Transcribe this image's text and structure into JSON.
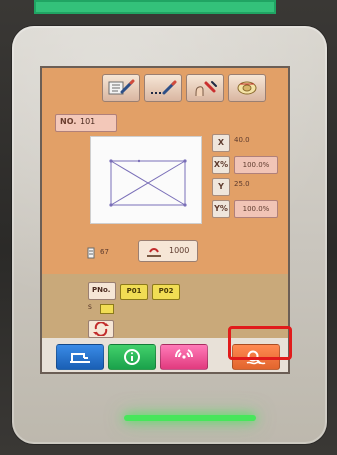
{
  "screen": {
    "pattern_no_label": "NO.",
    "pattern_no_value": "101",
    "x_label": "X",
    "x_value": "40.0",
    "x_scale_label": "X%",
    "x_scale_value": "100.0%",
    "y_label": "Y",
    "y_value": "25.0",
    "y_scale_label": "Y%",
    "y_scale_value": "100.0%",
    "speed_value": "67",
    "sew_count_value": "1000",
    "pno_label": "PNo.",
    "p01_label": "P01",
    "p02_label": "P02",
    "small_label": "S"
  },
  "icons": {
    "toolbar": [
      "edit-pen-icon",
      "stitch-line-icon",
      "hand-tools-icon",
      "thread-spool-icon"
    ],
    "bottom": [
      "sewing-machine-icon",
      "info-icon",
      "wireless-signal-icon",
      "search-magnifier-icon"
    ]
  },
  "colors": {
    "screen_bg": "#e2a067",
    "highlight": "#e11b1b",
    "led": "#47e65b",
    "top_bar": "#33c17a"
  }
}
